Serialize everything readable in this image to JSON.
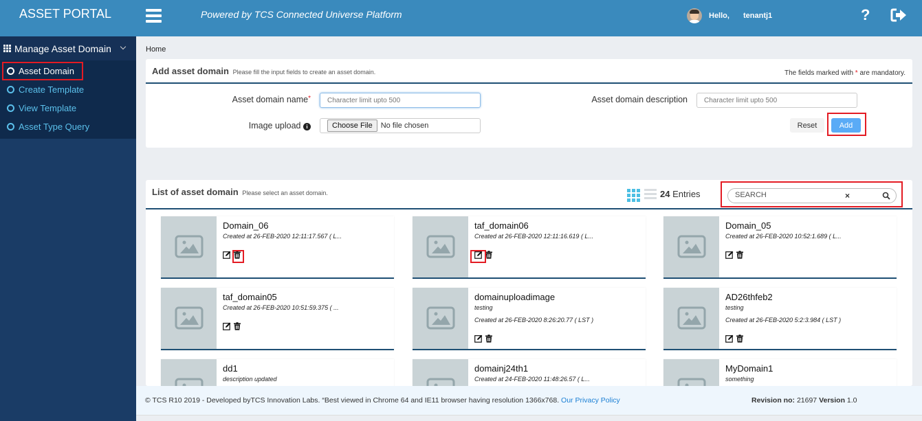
{
  "header": {
    "brand": "ASSET PORTAL",
    "powered_by": "Powered by TCS Connected Universe Platform",
    "greeting": "Hello,",
    "username": "tenantj1",
    "icons": [
      "menu-icon",
      "user-avatar",
      "help-icon",
      "logout-icon"
    ]
  },
  "sidebar": {
    "section_label": "Manage Asset Domain",
    "items": [
      {
        "label": "Asset Domain",
        "active": true
      },
      {
        "label": "Create Template",
        "active": false
      },
      {
        "label": "View Template",
        "active": false
      },
      {
        "label": "Asset Type Query",
        "active": false
      }
    ]
  },
  "breadcrumb": "Home",
  "add_panel": {
    "title": "Add asset domain",
    "subtitle": "Please fill the input fields to create an asset domain.",
    "mandatory_prefix": "The fields marked with ",
    "mandatory_star": "*",
    "mandatory_suffix": " are mandatory.",
    "name_label": "Asset domain name",
    "name_required": "*",
    "name_value": "",
    "name_placeholder": "Character limit upto 500",
    "image_label": "Image upload",
    "choose_file": "Choose File",
    "no_file": "No file chosen",
    "description_label": "Asset domain description",
    "description_value": "",
    "description_placeholder": "Character limit upto 500",
    "reset_label": "Reset",
    "add_label": "Add"
  },
  "list_panel": {
    "title": "List of asset domain",
    "subtitle": "Please select an asset domain.",
    "entries_count": "24",
    "entries_label": "Entries",
    "search_placeholder": "SEARCH",
    "search_value": "",
    "clear_symbol": "×",
    "cards": [
      {
        "name": "Domain_06",
        "description": "",
        "created": "Created at 26-FEB-2020 12:11:17.567 ( L..."
      },
      {
        "name": "taf_domain06",
        "description": "",
        "created": "Created at 26-FEB-2020 12:11:16.619 ( L..."
      },
      {
        "name": "Domain_05",
        "description": "",
        "created": "Created at 26-FEB-2020 10:52:1.689 ( L..."
      },
      {
        "name": "taf_domain05",
        "description": "",
        "created": "Created at 26-FEB-2020 10:51:59.375 ( ..."
      },
      {
        "name": "domainuploadimage",
        "description": "testing",
        "created": "Created at 26-FEB-2020 8:26:20.77 ( LST )"
      },
      {
        "name": "AD26thfeb2",
        "description": "testing",
        "created": "Created at 26-FEB-2020 5:2:3.984 ( LST )"
      },
      {
        "name": "dd1",
        "description": "description updated",
        "created": ""
      },
      {
        "name": "domainj24th1",
        "description": "",
        "created": "Created at 24-FEB-2020 11:48:26.57 ( L..."
      },
      {
        "name": "MyDomain1",
        "description": "something",
        "created": ""
      }
    ]
  },
  "footer": {
    "copyright": "© TCS R10 2019 - Developed byTCS Innovation Labs. “Best viewed in Chrome 64 and IE11 browser having resolution 1366x768. ",
    "privacy": "Our Privacy Policy",
    "revision_label": "Revision no:",
    "revision": "21697",
    "version_label": "Version",
    "version": "1.0"
  },
  "colors": {
    "header": "#3a8abd",
    "sidebar": "#1a3c66",
    "accent": "#5aabf6",
    "highlight_box": "#e31b23"
  }
}
